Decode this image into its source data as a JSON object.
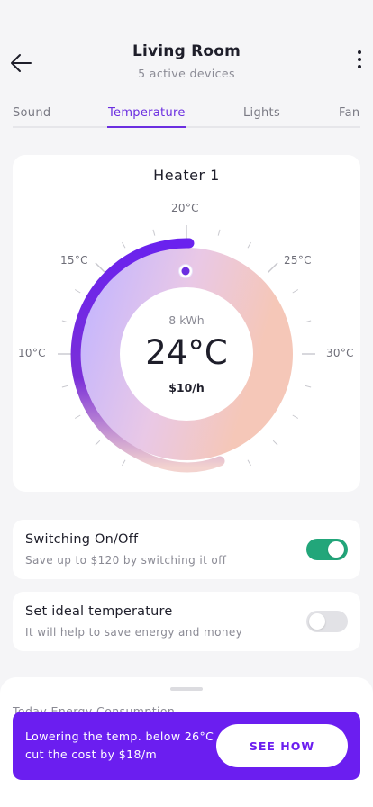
{
  "header": {
    "title": "Living Room",
    "subtitle": "5 active devices",
    "back_icon": "arrow-left-icon",
    "more_icon": "more-vertical-icon"
  },
  "tabs": [
    {
      "label": "Sound",
      "active": false
    },
    {
      "label": "Temperature",
      "active": true
    },
    {
      "label": "Lights",
      "active": false
    },
    {
      "label": "Fan",
      "active": false
    }
  ],
  "heater": {
    "title": "Heater 1",
    "energy": "8 kWh",
    "temperature": "24°C",
    "cost": "$10/h",
    "scale_labels": {
      "t10": "10°C",
      "t15": "15°C",
      "t20": "20°C",
      "t25": "25°C",
      "t30": "30°C"
    }
  },
  "settings": [
    {
      "title": "Switching On/Off",
      "description": "Save up to $120 by switching it off",
      "enabled": true
    },
    {
      "title": "Set ideal temperature",
      "description": "It will help to save energy and money",
      "enabled": false
    }
  ],
  "sheet": {
    "title": "Today Energy Consumption"
  },
  "promo": {
    "text": "Lowering the temp. below 26°C cut the cost by $18/m",
    "button_label": "SEE HOW"
  },
  "colors": {
    "accent": "#6b2ee0",
    "promo": "#6b1ef0",
    "toggle_on": "#22a67a"
  }
}
